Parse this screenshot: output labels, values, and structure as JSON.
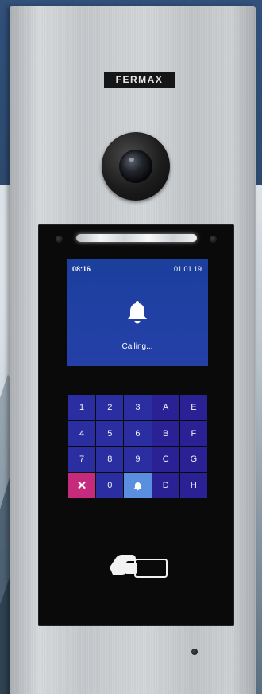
{
  "panel": {
    "brand": "FERMAX"
  },
  "screen": {
    "time": "08:16",
    "date": "01.01.19",
    "status": "Calling...",
    "icon": "bell-icon",
    "background_color": "#2140a4"
  },
  "keypad": {
    "keys": [
      {
        "label": "1",
        "type": "num"
      },
      {
        "label": "2",
        "type": "num"
      },
      {
        "label": "3",
        "type": "num"
      },
      {
        "label": "A",
        "type": "alpha"
      },
      {
        "label": "E",
        "type": "alpha"
      },
      {
        "label": "4",
        "type": "num"
      },
      {
        "label": "5",
        "type": "num"
      },
      {
        "label": "6",
        "type": "num"
      },
      {
        "label": "B",
        "type": "alpha"
      },
      {
        "label": "F",
        "type": "alpha"
      },
      {
        "label": "7",
        "type": "num"
      },
      {
        "label": "8",
        "type": "num"
      },
      {
        "label": "9",
        "type": "num"
      },
      {
        "label": "C",
        "type": "alpha"
      },
      {
        "label": "G",
        "type": "alpha"
      },
      {
        "label": "✕",
        "type": "cancel"
      },
      {
        "label": "0",
        "type": "num"
      },
      {
        "label": "",
        "type": "bell"
      },
      {
        "label": "D",
        "type": "alpha"
      },
      {
        "label": "H",
        "type": "alpha"
      }
    ],
    "cancel_color": "#c52a7c",
    "bell_color": "#5a8fe0",
    "key_color": "#2b2ea0"
  },
  "icons": {
    "camera": "camera-lens-icon",
    "reader": "rfid-card-reader-icon",
    "microphone": "microphone-hole-icon",
    "led": "led-light-bar"
  }
}
